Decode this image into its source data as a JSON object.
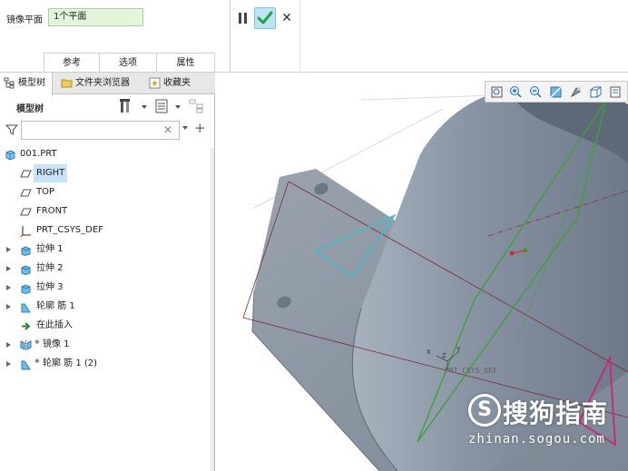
{
  "dashboard": {
    "mirror_plane_label": "镜像平面",
    "mirror_plane_value": "1个平面",
    "tabs": [
      "参考",
      "选项",
      "属性"
    ]
  },
  "panel": {
    "tabs": [
      "模型树",
      "文件夹浏览器",
      "收藏夹"
    ],
    "tree_header": "模型树"
  },
  "tree": {
    "items": [
      {
        "label": "001.PRT",
        "icon": "part-icon"
      },
      {
        "label": "RIGHT",
        "icon": "datum-plane-icon",
        "selected": true
      },
      {
        "label": "TOP",
        "icon": "datum-plane-icon"
      },
      {
        "label": "FRONT",
        "icon": "datum-plane-icon"
      },
      {
        "label": "PRT_CSYS_DEF",
        "icon": "csys-icon"
      },
      {
        "label": "拉伸 1",
        "icon": "extrude-icon"
      },
      {
        "label": "拉伸 2",
        "icon": "extrude-icon"
      },
      {
        "label": "拉伸 3",
        "icon": "extrude-icon"
      },
      {
        "label": "轮廓 筋 1",
        "icon": "rib-icon"
      },
      {
        "label": "在此插入",
        "icon": "insert-arrow-icon"
      },
      {
        "label": "镜像 1",
        "icon": "mirror-icon"
      },
      {
        "label": "轮廓 筋 1 (2)",
        "icon": "rib-icon"
      }
    ]
  },
  "viewport": {
    "csys_label": "PRT_CSYS_DEF",
    "axis_labels": [
      "X",
      "Z",
      "Y"
    ]
  },
  "watermark": {
    "brand": "搜狗指南",
    "url": "zhinan.sogou.com"
  },
  "colors": {
    "ok_green": "#27a244",
    "model_gray": "#8c96a4",
    "plane_green": "#3da03b",
    "rib_cyan": "#4fb6c2",
    "rib_magenta": "#c22e7a"
  }
}
